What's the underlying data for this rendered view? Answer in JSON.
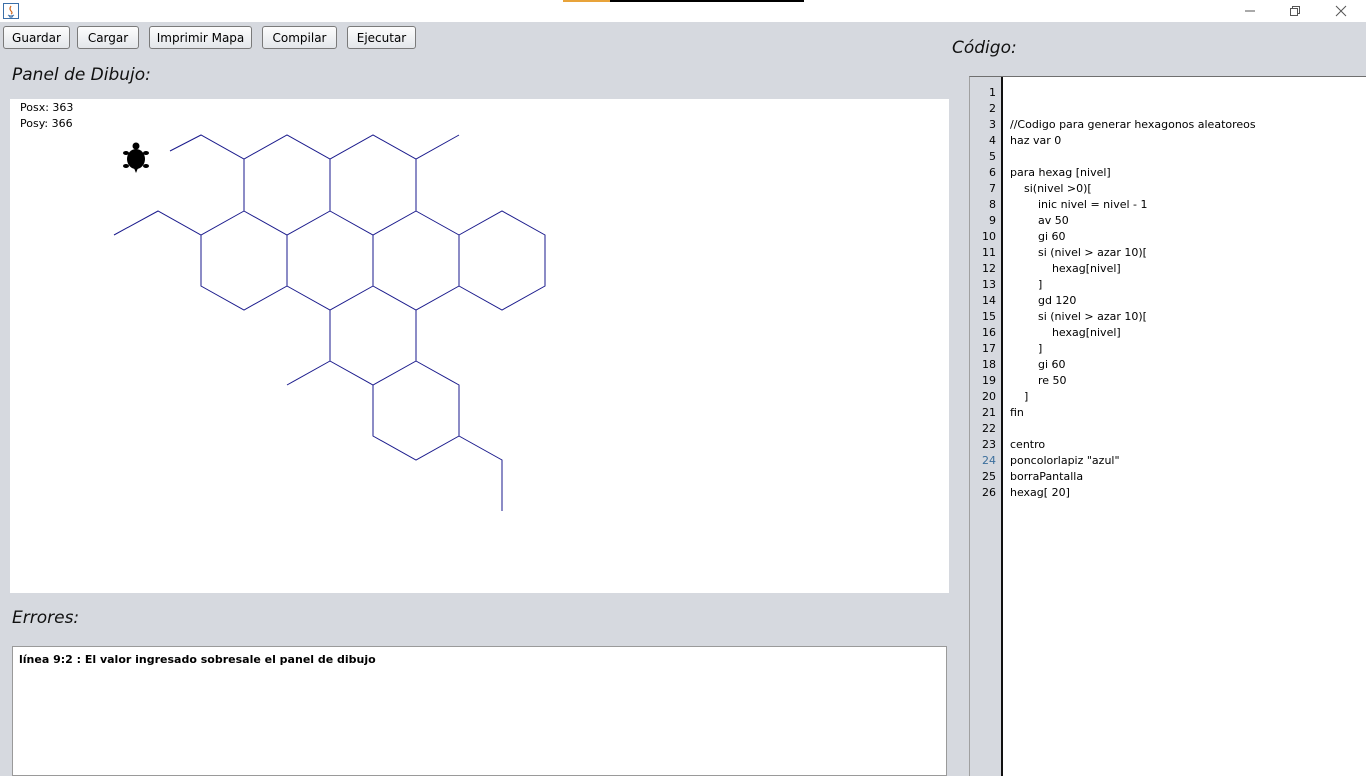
{
  "toolbar": {
    "buttons": [
      "Guardar",
      "Cargar",
      "Imprimir Mapa",
      "Compilar",
      "Ejecutar"
    ]
  },
  "drawing_panel": {
    "title": "Panel de Dibujo:",
    "posx_label": "Posx: 363",
    "posy_label": "Posy: 366",
    "stroke_color": "#1a1a8c",
    "turtle_icon": "turtle-icon"
  },
  "errors_panel": {
    "title": "Errores:",
    "message": "línea 9:2 :  El valor ingresado sobresale el panel de dibujo"
  },
  "code_panel": {
    "title": "Código:",
    "active_line": 24,
    "lines": [
      "",
      "",
      "//Codigo para generar hexagonos aleatoreos",
      "haz var 0",
      "",
      "para hexag [nivel]",
      "    si(nivel >0)[",
      "        inic nivel = nivel - 1",
      "        av 50",
      "        gi 60",
      "        si (nivel > azar 10)[",
      "            hexag[nivel]",
      "        ]",
      "        gd 120",
      "        si (nivel > azar 10)[",
      "            hexag[nivel]",
      "        ]",
      "        gi 60",
      "        re 50",
      "    ]",
      "fin",
      "",
      "centro",
      "poncolorlapiz \"azul\"",
      "borraPantalla",
      "hexag[ 20]"
    ]
  },
  "window_controls": [
    "minimize-icon",
    "restore-icon",
    "close-icon"
  ]
}
